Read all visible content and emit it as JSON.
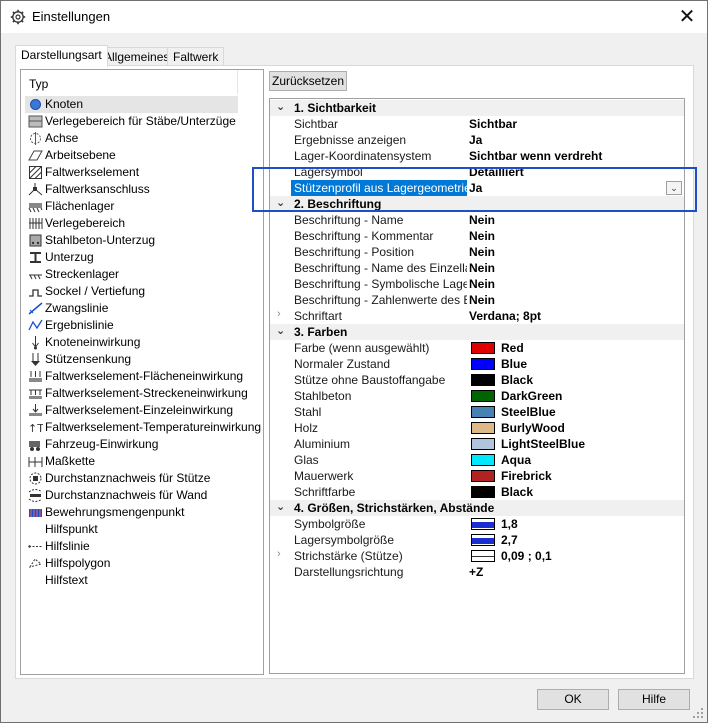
{
  "window": {
    "title": "Einstellungen",
    "close_glyph": "✕"
  },
  "tabs": [
    {
      "label": "Darstellungsart",
      "active": true
    },
    {
      "label": "Allgemeines",
      "active": false
    },
    {
      "label": "Faltwerk",
      "active": false
    }
  ],
  "typelist": {
    "header": "Typ",
    "items": [
      {
        "label": "Knoten",
        "icon": "node-icon",
        "selected": true
      },
      {
        "label": "Verlegebereich für Stäbe/Unterzüge",
        "icon": "bar-laying-area-icon"
      },
      {
        "label": "Achse",
        "icon": "axis-icon"
      },
      {
        "label": "Arbeitsebene",
        "icon": "work-plane-icon"
      },
      {
        "label": "Faltwerkselement",
        "icon": "folded-plate-element-icon"
      },
      {
        "label": "Faltwerksanschluss",
        "icon": "folded-plate-connection-icon"
      },
      {
        "label": "Flächenlager",
        "icon": "area-support-icon"
      },
      {
        "label": "Verlegebereich",
        "icon": "laying-area-icon"
      },
      {
        "label": "Stahlbeton-Unterzug",
        "icon": "rc-beam-icon"
      },
      {
        "label": "Unterzug",
        "icon": "beam-icon"
      },
      {
        "label": "Streckenlager",
        "icon": "line-support-icon"
      },
      {
        "label": "Sockel / Vertiefung",
        "icon": "pedestal-icon"
      },
      {
        "label": "Zwangslinie",
        "icon": "constraint-line-icon"
      },
      {
        "label": "Ergebnislinie",
        "icon": "result-line-icon"
      },
      {
        "label": "Knoteneinwirkung",
        "icon": "node-action-icon"
      },
      {
        "label": "Stützensenkung",
        "icon": "column-settlement-icon"
      },
      {
        "label": "Faltwerkselement-Flächeneinwirkung",
        "icon": "area-action-icon"
      },
      {
        "label": "Faltwerkselement-Streckeneinwirkung",
        "icon": "line-action-icon"
      },
      {
        "label": "Faltwerkselement-Einzeleinwirkung",
        "icon": "point-action-icon"
      },
      {
        "label": "Faltwerkselement-Temperatureinwirkung",
        "icon": "temperature-action-icon"
      },
      {
        "label": "Fahrzeug-Einwirkung",
        "icon": "vehicle-action-icon"
      },
      {
        "label": "Maßkette",
        "icon": "dimension-chain-icon"
      },
      {
        "label": "Durchstanznachweis für Stütze",
        "icon": "punching-column-icon"
      },
      {
        "label": "Durchstanznachweis für Wand",
        "icon": "punching-wall-icon"
      },
      {
        "label": "Bewehrungsmengenpunkt",
        "icon": "reinforcement-point-icon"
      },
      {
        "label": "Hilfspunkt",
        "icon": ""
      },
      {
        "label": "Hilfslinie",
        "icon": "helper-line-icon"
      },
      {
        "label": "Hilfspolygon",
        "icon": "helper-polygon-icon"
      },
      {
        "label": "Hilfstext",
        "icon": ""
      }
    ]
  },
  "reset_button": "Zurücksetzen",
  "grid": {
    "rows": [
      {
        "type": "cat",
        "label": "1. Sichtbarkeit",
        "glyph": "⌄"
      },
      {
        "type": "prop",
        "name": "Sichtbar",
        "value": "Sichtbar"
      },
      {
        "type": "prop",
        "name": "Ergebnisse anzeigen",
        "value": "Ja"
      },
      {
        "type": "prop",
        "name": "Lager-Koordinatensystem",
        "value": "Sichtbar wenn verdreht"
      },
      {
        "type": "prop",
        "name": "Lagersymbol",
        "value": "Detailliert"
      },
      {
        "type": "prop",
        "name": "Stützenprofil aus Lagergeometrie zeichnen",
        "value": "Ja",
        "selected": true,
        "dropdown": true
      },
      {
        "type": "cat",
        "label": "2. Beschriftung",
        "glyph": "⌄"
      },
      {
        "type": "prop",
        "name": "Beschriftung - Name",
        "value": "Nein"
      },
      {
        "type": "prop",
        "name": "Beschriftung - Kommentar",
        "value": "Nein"
      },
      {
        "type": "prop",
        "name": "Beschriftung - Position",
        "value": "Nein"
      },
      {
        "type": "prop",
        "name": "Beschriftung - Name des Einzellagers",
        "value": "Nein"
      },
      {
        "type": "prop",
        "name": "Beschriftung - Symbolische Lagerwerte",
        "value": "Nein"
      },
      {
        "type": "prop",
        "name": "Beschriftung - Zahlenwerte des Einzellagers",
        "value": "Nein"
      },
      {
        "type": "prop",
        "name": "Schriftart",
        "value": "Verdana; 8pt",
        "expandable": true
      },
      {
        "type": "cat",
        "label": "3. Farben",
        "glyph": "⌄"
      },
      {
        "type": "prop",
        "name": "Farbe (wenn ausgewählt)",
        "value": "Red",
        "swatch": "#e00000"
      },
      {
        "type": "prop",
        "name": "Normaler Zustand",
        "value": "Blue",
        "swatch": "#0000ff"
      },
      {
        "type": "prop",
        "name": "Stütze ohne Baustoffangabe",
        "value": "Black",
        "swatch": "#000000"
      },
      {
        "type": "prop",
        "name": "Stahlbeton",
        "value": "DarkGreen",
        "swatch": "#006400"
      },
      {
        "type": "prop",
        "name": "Stahl",
        "value": "SteelBlue",
        "swatch": "#4682b4"
      },
      {
        "type": "prop",
        "name": "Holz",
        "value": "BurlyWood",
        "swatch": "#deb887"
      },
      {
        "type": "prop",
        "name": "Aluminium",
        "value": "LightSteelBlue",
        "swatch": "#b0c4de"
      },
      {
        "type": "prop",
        "name": "Glas",
        "value": "Aqua",
        "swatch": "#00e8ff"
      },
      {
        "type": "prop",
        "name": "Mauerwerk",
        "value": "Firebrick",
        "swatch": "#b22222"
      },
      {
        "type": "prop",
        "name": "Schriftfarbe",
        "value": "Black",
        "swatch": "#000000"
      },
      {
        "type": "cat",
        "label": "4. Größen, Strichstärken, Abstände",
        "glyph": "⌄"
      },
      {
        "type": "prop",
        "name": "Symbolgröße",
        "value": "1,8",
        "swatch": "blue-line"
      },
      {
        "type": "prop",
        "name": "Lagersymbolgröße",
        "value": "2,7",
        "swatch": "blue-line"
      },
      {
        "type": "prop",
        "name": "Strichstärke (Stütze)",
        "value": "0,09 ; 0,1",
        "swatch": "thin-line",
        "expandable": true
      },
      {
        "type": "prop",
        "name": "Darstellungsrichtung",
        "value": "+Z"
      }
    ]
  },
  "footer": {
    "ok": "OK",
    "help": "Hilfe"
  },
  "colors": {
    "selection": "#0078d7",
    "highlight_frame": "#1f4fc4"
  }
}
